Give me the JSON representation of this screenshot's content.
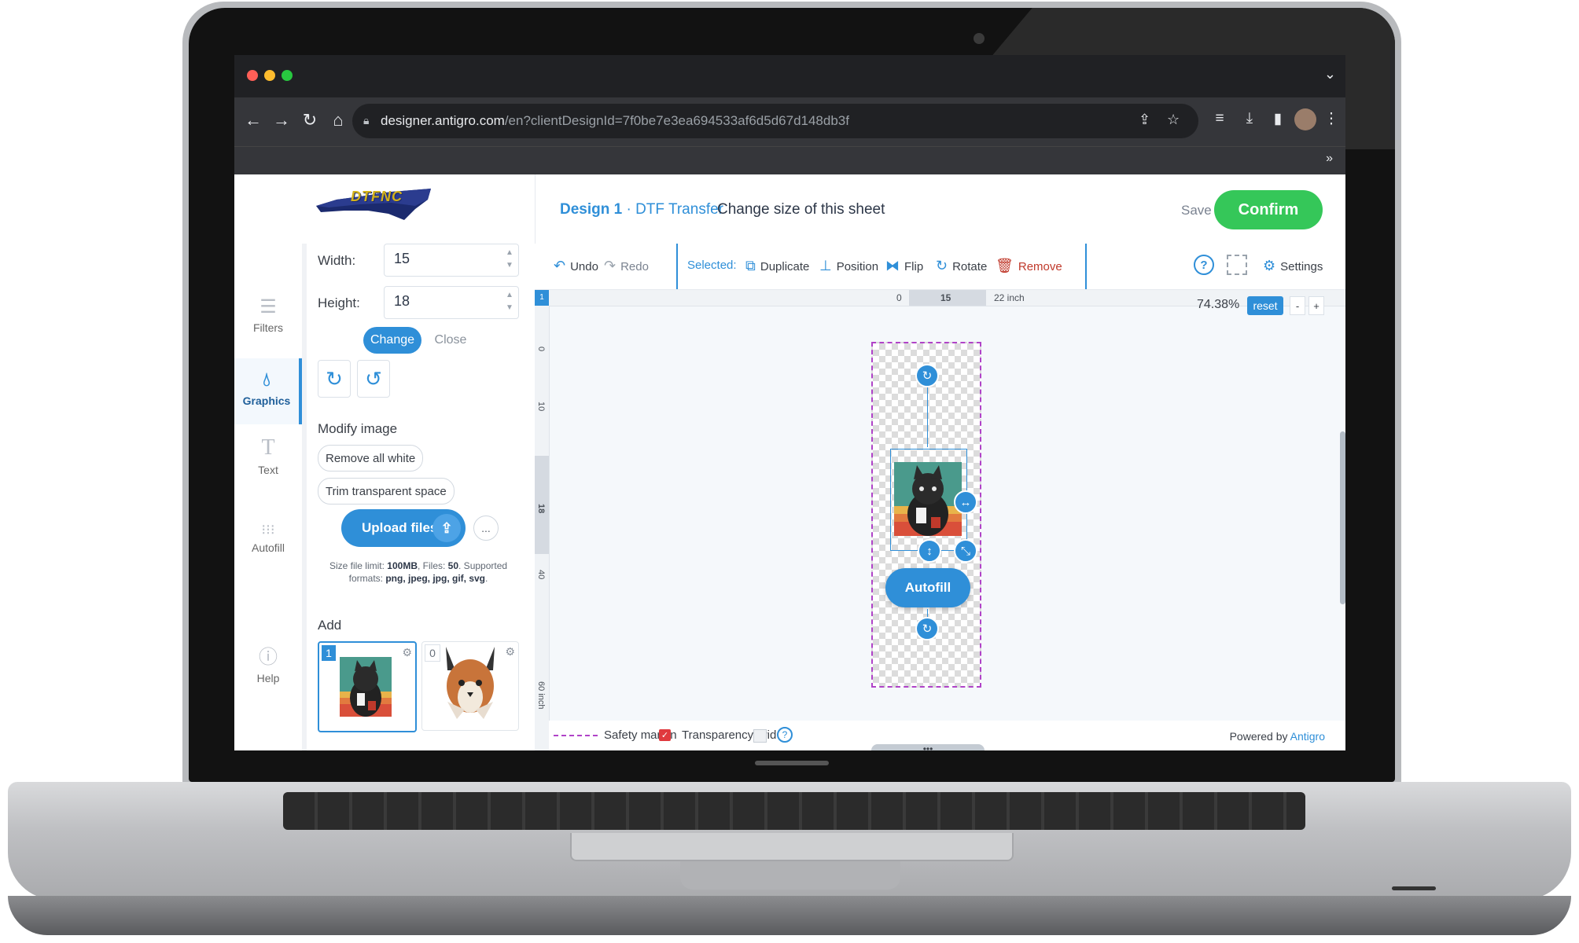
{
  "browser": {
    "url_domain": "designer.antigro.com",
    "url_path": "/en?clientDesignId=7f0be7e3ea694533af6d5d67d148db3f"
  },
  "header": {
    "logo_text": "DTFNC",
    "design_name": "Design 1",
    "design_sub": " · DTF Transfer",
    "change_size_link": "Change size of this sheet",
    "save_label": "Save",
    "confirm_label": "Confirm"
  },
  "rail": {
    "items": [
      {
        "label": "Filters",
        "icon": "filters-icon"
      },
      {
        "label": "Graphics",
        "icon": "graphics-icon"
      },
      {
        "label": "Text",
        "icon": "text-icon"
      },
      {
        "label": "Autofill",
        "icon": "autofill-icon"
      },
      {
        "label": "Help",
        "icon": "help-icon"
      }
    ]
  },
  "panel": {
    "width_label": "Width:",
    "width_value": "15",
    "height_label": "Height:",
    "height_value": "18",
    "change_label": "Change",
    "close_label": "Close",
    "modify_title": "Modify image",
    "remove_white_label": "Remove all white",
    "trim_label": "Trim transparent space",
    "upload_label": "Upload files",
    "more_label": "...",
    "limit_prefix": "Size file limit: ",
    "limit_size": "100MB",
    "limit_files_prefix": ", Files: ",
    "limit_files": "50",
    "limit_formats_prefix": ". Supported formats: ",
    "limit_formats": "png, jpeg, jpg, gif, svg",
    "limit_end": ".",
    "add_title": "Add",
    "thumbs": [
      {
        "count": "1"
      },
      {
        "count": "0"
      }
    ]
  },
  "toolbar": {
    "undo": "Undo",
    "redo": "Redo",
    "selected": "Selected:",
    "duplicate": "Duplicate",
    "position": "Position",
    "flip": "Flip",
    "rotate": "Rotate",
    "remove": "Remove",
    "help": "?",
    "settings": "Settings"
  },
  "canvas": {
    "ruler_corner": "1",
    "ruler_zero": "0",
    "ruler_width": "15",
    "ruler_end": "22 inch",
    "ruler_left": [
      "0",
      "10",
      "18",
      "40",
      "60 inch"
    ],
    "zoom_value": "74.38%",
    "reset_label": "reset",
    "zoom_out": "-",
    "zoom_in": "+",
    "autofill_label": "Autofill",
    "safety_margin_label": "Safety margin",
    "transparency_label": "Transparency grid",
    "powered_prefix": "Powered by ",
    "powered_brand": "Antigro",
    "hscroll_dots": "•••"
  },
  "colors": {
    "accent": "#2f8fd8",
    "confirm": "#35c759",
    "remove": "#c0392b",
    "safety_margin": "#b043c8"
  }
}
